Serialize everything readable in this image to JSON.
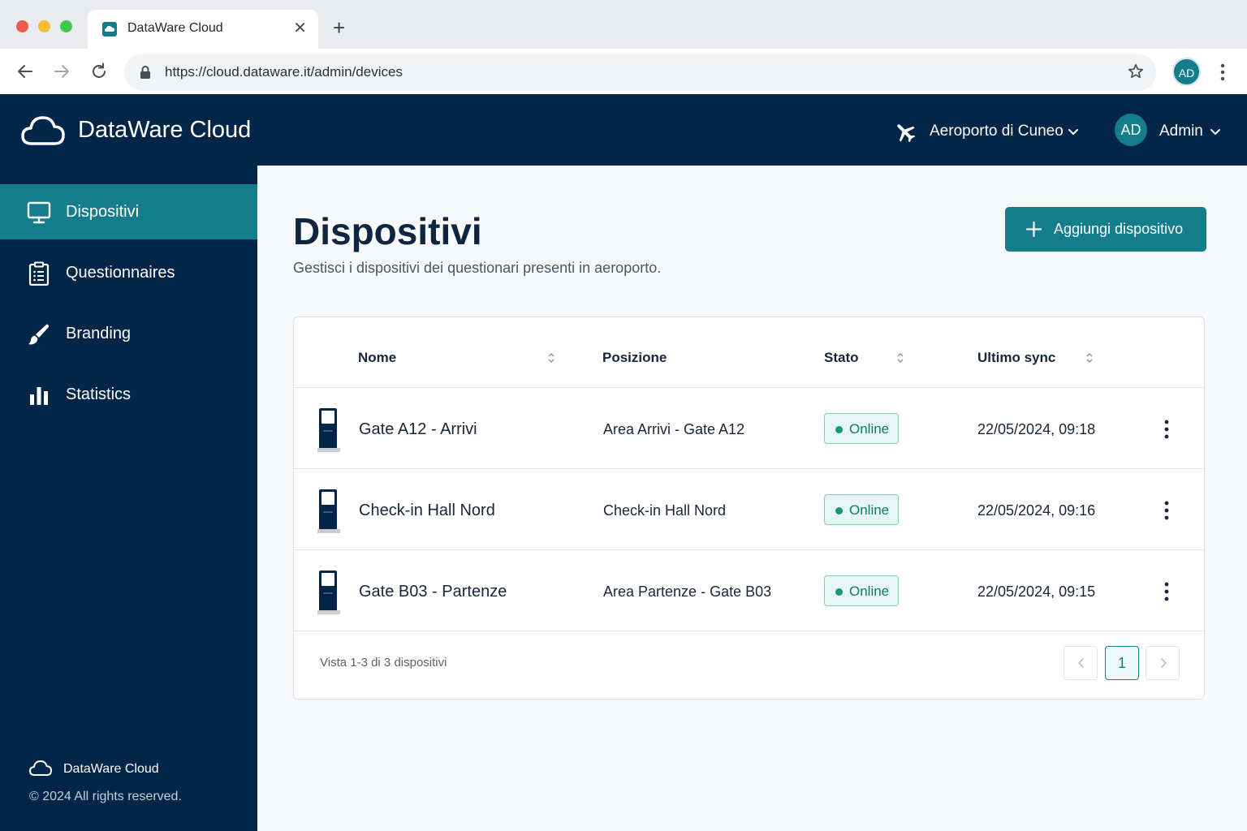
{
  "browser": {
    "tab_title": "DataWare Cloud",
    "url": "https://cloud.dataware.it/admin/devices",
    "profile_initials": "AD"
  },
  "header": {
    "app_name": "DataWare Cloud",
    "airport": "Aeroporto di Cuneo",
    "user_initials": "AD",
    "user_name": "Admin"
  },
  "sidebar": {
    "items": [
      {
        "label": "Dispositivi",
        "icon": "monitor-icon",
        "active": true
      },
      {
        "label": "Questionnaires",
        "icon": "clipboard-icon",
        "active": false
      },
      {
        "label": "Branding",
        "icon": "brush-icon",
        "active": false
      },
      {
        "label": "Statistics",
        "icon": "bar-chart-icon",
        "active": false
      }
    ],
    "footer_name": "DataWare Cloud",
    "footer_copyright": "© 2024 All rights reserved."
  },
  "main": {
    "title": "Dispositivi",
    "subtitle": "Gestisci i dispositivi dei questionari presenti in aeroporto.",
    "add_button": "Aggiungi dispositivo"
  },
  "table": {
    "columns": [
      "Nome",
      "Posizione",
      "Stato",
      "Ultimo sync"
    ],
    "rows": [
      {
        "name": "Gate A12 - Arrivi",
        "position": "Area Arrivi - Gate A12",
        "status": "Online",
        "sync": "22/05/2024, 09:18"
      },
      {
        "name": "Check-in Hall Nord",
        "position": "Check-in Hall Nord",
        "status": "Online",
        "sync": "22/05/2024, 09:16"
      },
      {
        "name": "Gate B03 - Partenze",
        "position": "Area Partenze - Gate B03",
        "status": "Online",
        "sync": "22/05/2024, 09:15"
      }
    ],
    "footer": "Vista 1-3 di 3 dispositivi",
    "current_page": "1"
  },
  "colors": {
    "navy": "#032548",
    "teal": "#137d8c",
    "online_green": "#129a7a"
  }
}
